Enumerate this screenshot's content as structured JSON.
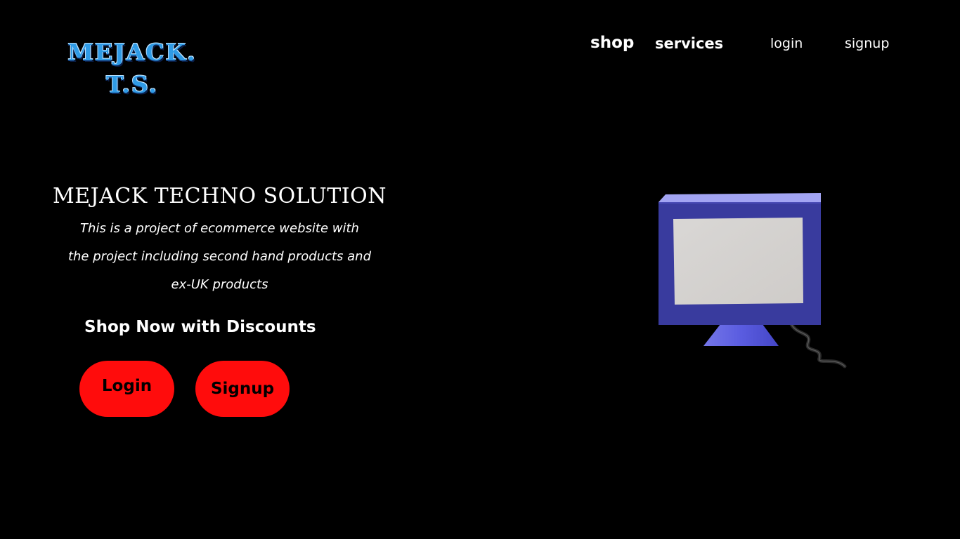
{
  "logo": {
    "line1": "MEJACK.",
    "line2": "T.S."
  },
  "nav": {
    "shop": "shop",
    "services": "services",
    "login": "login",
    "signup": "signup"
  },
  "hero": {
    "title": "MEJACK TECHNO SOLUTION",
    "description_lines": [
      "This is a project of ecommerce website with",
      "the project including second hand products and",
      "ex-UK products"
    ],
    "cta": "Shop Now with Discounts",
    "login_button": "Login",
    "signup_button": "Signup"
  },
  "illustration": {
    "icon": "computer-monitor-icon"
  },
  "colors": {
    "background": "#000000",
    "logo": "#2f9be6",
    "button": "#ff0c0c",
    "button_text": "#000000",
    "monitor_frame": "#3a3ca0",
    "monitor_screen": "#d6d4d2"
  }
}
